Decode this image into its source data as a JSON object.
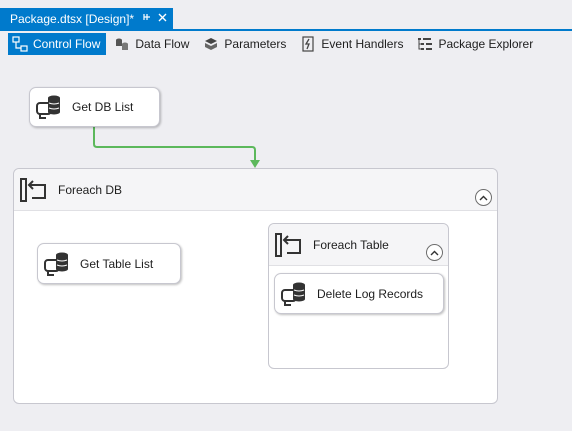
{
  "document_tab": {
    "title": "Package.dtsx [Design]*",
    "pin_icon": "pin-icon",
    "close_icon": "close-icon"
  },
  "designer_tabs": [
    {
      "label": "Control Flow",
      "icon": "control-flow-icon",
      "active": true
    },
    {
      "label": "Data Flow",
      "icon": "data-flow-icon",
      "active": false
    },
    {
      "label": "Parameters",
      "icon": "parameters-icon",
      "active": false
    },
    {
      "label": "Event Handlers",
      "icon": "event-handlers-icon",
      "active": false
    },
    {
      "label": "Package Explorer",
      "icon": "package-explorer-icon",
      "active": false
    }
  ],
  "tasks": {
    "get_db_list": {
      "label": "Get DB List",
      "icon": "execute-sql-task-icon"
    },
    "get_table_list": {
      "label": "Get Table List",
      "icon": "execute-sql-task-icon"
    },
    "delete_log_records": {
      "label": "Delete Log Records",
      "icon": "execute-sql-task-icon"
    }
  },
  "containers": {
    "foreach_db": {
      "label": "Foreach DB",
      "icon": "foreach-loop-icon",
      "state": "expanded"
    },
    "foreach_table": {
      "label": "Foreach Table",
      "icon": "foreach-loop-icon",
      "state": "expanded"
    }
  },
  "colors": {
    "accent": "#007acc",
    "connector": "#5cb85c",
    "canvas": "#eeeef2"
  }
}
